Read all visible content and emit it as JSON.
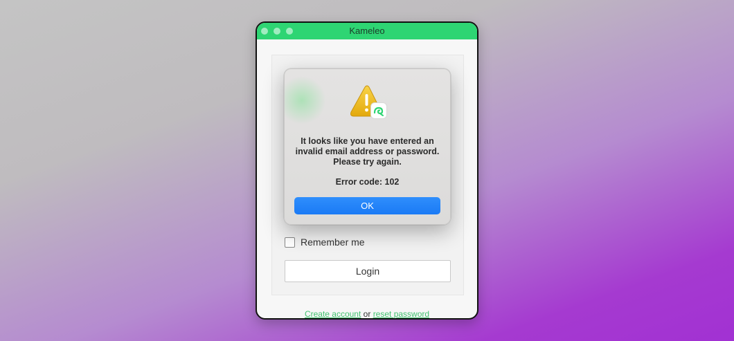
{
  "window": {
    "title": "Kameleo",
    "accent_color": "#2ed573"
  },
  "form": {
    "remember_label": "Remember me",
    "remember_checked": false,
    "login_label": "Login"
  },
  "footer": {
    "create_account": "Create account",
    "separator": "or",
    "reset_password": "reset password",
    "link_color": "#41c26f"
  },
  "dialog": {
    "icon": "warning-icon",
    "badge_icon": "kameleo-logo-icon",
    "message": "It looks like you have entered an invalid email address or password. Please try again.",
    "error_code": "Error code: 102",
    "ok_label": "OK",
    "button_color": "#1a7af5"
  }
}
